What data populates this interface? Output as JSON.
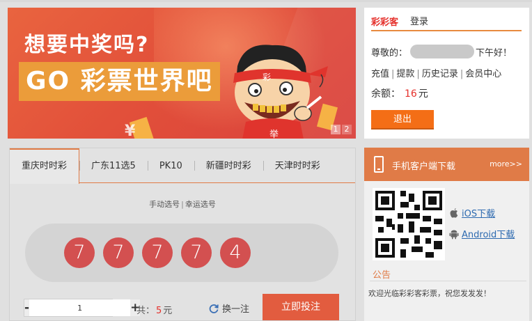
{
  "banner": {
    "headline": "想要中奖吗?",
    "slogan": "GO 彩票世界吧",
    "mascot_band_text": "彩",
    "mascot_shirt_text": "举",
    "yen_symbol": "¥",
    "pager": [
      "1",
      "2"
    ],
    "colors": {
      "background": "#e2503a",
      "slogan_bg": "#eb9c3a"
    }
  },
  "login": {
    "brand": "彩彩客",
    "title": "登录",
    "greeting_prefix": "尊敬的：",
    "greeting_suffix": "下午好！",
    "links": [
      "充值",
      "提款",
      "历史记录",
      "会员中心"
    ],
    "link_separator": "|",
    "balance_label": "余额：",
    "balance_amount": "16",
    "balance_unit": "元",
    "logout_label": "退出"
  },
  "lottery": {
    "tabs": [
      "重庆时时彩",
      "广东11选5",
      "PK10",
      "新疆时时彩",
      "天津时时彩"
    ],
    "active_tab": 0,
    "modes": [
      "手动选号",
      "幸运选号"
    ],
    "mode_separator": "|",
    "balls": [
      "7",
      "7",
      "7",
      "7",
      "4"
    ],
    "quantity": "1",
    "minus_label": "-",
    "plus_label": "+",
    "total_label": "共：",
    "total_amount": "5",
    "total_unit": "元",
    "refresh_label": "换一注",
    "bet_label": "立即投注",
    "colors": {
      "ball": "#d35050",
      "accent": "#e07a45",
      "bet_button": "#e25c3f"
    }
  },
  "app": {
    "title": "手机客户端下载",
    "more": "more>>",
    "ios_label": "iOS下载",
    "android_label": "Android下载",
    "notice_title": "公告",
    "notice_text": "欢迎光临彩彩客彩票，祝您发发发！",
    "colors": {
      "header": "#e07b47",
      "link": "#2d6ab0"
    }
  },
  "icons": [
    "phone-icon",
    "apple-icon",
    "android-icon",
    "refresh-icon",
    "qr-code-icon"
  ]
}
